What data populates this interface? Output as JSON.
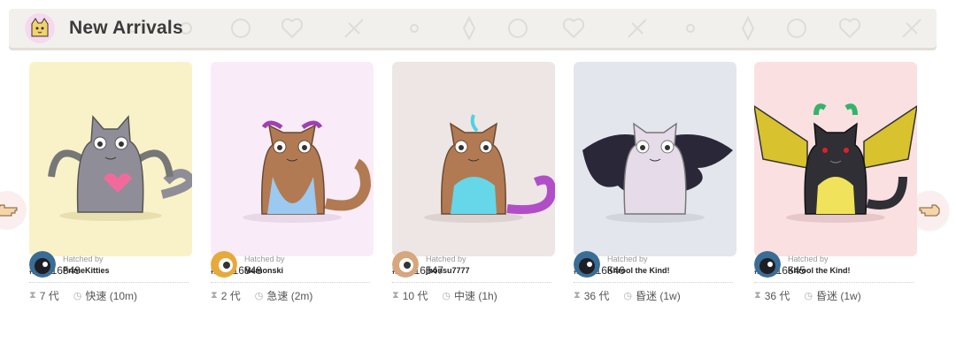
{
  "header": {
    "title": "New Arrivals",
    "avatar_icon": "cat-face-icon"
  },
  "nav": {
    "prev_icon": "pointing-hand-left-icon",
    "next_icon": "pointing-hand-right-icon"
  },
  "cards": [
    {
      "id": "2016549",
      "generation": "7 代",
      "cooldown": "快速 (10m)",
      "hatched_label": "Hatched by",
      "hatcher": "PrimeKitties",
      "bg": "#f9f2c8",
      "body_color": "#8f8e98",
      "avatar_color": "#3a6d96"
    },
    {
      "id": "2016548",
      "generation": "2 代",
      "cooldown": "急速 (2m)",
      "hatched_label": "Hatched by",
      "hatcher": "Memonski",
      "bg": "#f9ecf8",
      "body_color": "#b27a52",
      "avatar_color": "#e8a93c"
    },
    {
      "id": "2016547",
      "generation": "10 代",
      "cooldown": "中速 (1h)",
      "hatched_label": "Hatched by",
      "hatcher": "jhonsu7777",
      "bg": "#ede6e4",
      "body_color": "#b27a52",
      "avatar_color": "#d7a67c"
    },
    {
      "id": "2016546",
      "generation": "36 代",
      "cooldown": "昏迷 (1w)",
      "hatched_label": "Hatched by",
      "hatcher": "Khrool the Kind!",
      "bg": "#e4e6ee",
      "body_color": "#e6dbe8",
      "avatar_color": "#3a6d96"
    },
    {
      "id": "2016545",
      "generation": "36 代",
      "cooldown": "昏迷 (1w)",
      "hatched_label": "Hatched by",
      "hatcher": "Khrool the Kind!",
      "bg": "#fbe0e2",
      "body_color": "#2f2f35",
      "avatar_color": "#3a6d96"
    }
  ]
}
